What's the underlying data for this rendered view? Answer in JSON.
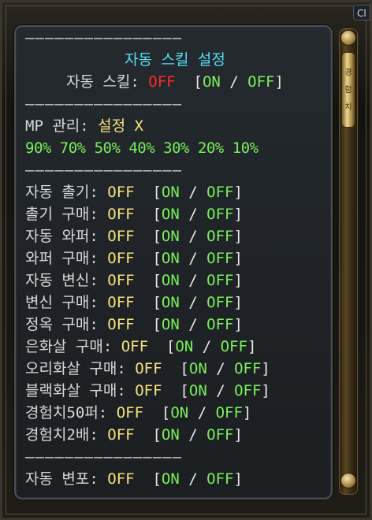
{
  "window": {
    "close_label": "Cl"
  },
  "separator": "――――――――――――――――",
  "header": {
    "title": "자동 스킬 설정",
    "auto_skill_label": "자동 스킬: ",
    "auto_skill_value": "OFF",
    "toggle_open": "[",
    "toggle_on": "ON",
    "toggle_slash": " / ",
    "toggle_off": "OFF",
    "toggle_close": "]"
  },
  "mp": {
    "label": "MP 관리: ",
    "value": "설정 X",
    "percents": [
      "90%",
      "70%",
      "50%",
      "40%",
      "30%",
      "20%",
      "10%"
    ]
  },
  "settings": [
    {
      "label": "자동 촐기: ",
      "value": "OFF"
    },
    {
      "label": "촐기 구매: ",
      "value": "OFF"
    },
    {
      "label": "자동 와퍼: ",
      "value": "OFF"
    },
    {
      "label": "와퍼 구매: ",
      "value": "OFF"
    },
    {
      "label": "자동 변신: ",
      "value": "OFF"
    },
    {
      "label": "변신 구매: ",
      "value": "OFF"
    },
    {
      "label": "정옥 구매: ",
      "value": "OFF"
    },
    {
      "label": "은화살 구매: ",
      "value": "OFF"
    },
    {
      "label": "오리화살 구매: ",
      "value": "OFF"
    },
    {
      "label": "블랙화살 구매: ",
      "value": "OFF"
    },
    {
      "label": "경험치50퍼: ",
      "value": "OFF"
    },
    {
      "label": "경험치2배: ",
      "value": "OFF"
    }
  ],
  "footer_partial": {
    "label": "자동 변포: ",
    "value": "OFF"
  },
  "colors": {
    "title": "#55e0f0",
    "off_red": "#ff2a2a",
    "off_yellow": "#f6e27a",
    "on_green": "#78f05a"
  },
  "scrollbar": {
    "thumb_glyphs": [
      "경",
      "험",
      "치"
    ]
  }
}
